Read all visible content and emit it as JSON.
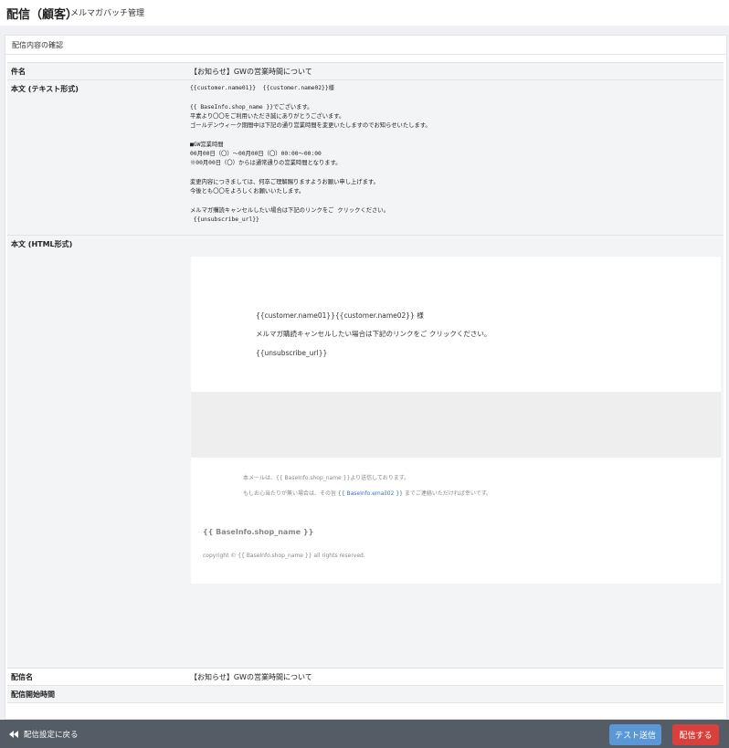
{
  "header": {
    "title": "配信（顧客）",
    "subtitle": "メルマガバッチ管理"
  },
  "card": {
    "title": "配信内容の確認"
  },
  "rows": {
    "subject": {
      "label": "件名",
      "value": "【お知らせ】GWの営業時間について"
    },
    "text_body": {
      "label": "本文 (テキスト形式)",
      "lines": [
        "{{customer.name01}}  {{customer.name02}}様",
        "",
        "{{ BaseInfo.shop_name }}でございます。",
        "平素より〇〇をご利用いただき誠にありがとうございます。",
        "ゴールデンウィーク期間中は下記の通り営業時間を変更いたしますのでお知らせいたします。",
        "",
        "■GW営業時間",
        "00月00日（〇）～00月00日（〇）00:00～00:00",
        "※00月00日（〇）からは通常通りの営業時間となります。",
        "",
        "変更内容につきましては、何卒ご理解賜りますようお願い申し上げます。",
        "今後とも〇〇をよろしくお願いいたします。",
        "",
        "メルマガ購読キャンセルしたい場合は下記のリンクをご クリックください。",
        " {{unsubscribe_url}}"
      ]
    },
    "html_body": {
      "label": "本文 (HTML形式)",
      "greeting": "{{customer.name01}}{{customer.name02}} 様",
      "cancel_text": "メルマガ購読キャンセルしたい場合は下記のリンクをご クリックください。",
      "unsubscribe": "{{unsubscribe_url}}",
      "footer_line1": "本メールは、{{ BaseInfo.shop_name }}より送信しております。",
      "footer_line2_before": "もしお心当たりが無い場合は、その旨 ",
      "footer_line2_link": "{{ BaseInfo.email02 }}",
      "footer_line2_after": " までご連絡いただければ幸いです。",
      "footer_shop": "{{ BaseInfo.shop_name }}",
      "footer_copyright": "copyright © {{ BaseInfo.shop_name }} all rights reserved."
    },
    "delivery_name": {
      "label": "配信名",
      "value": "【お知らせ】GWの営業時間について"
    },
    "delivery_start": {
      "label": "配信開始時間",
      "value": ""
    }
  },
  "footer": {
    "back_label": "配信設定に戻る",
    "test_label": "テスト送信",
    "send_label": "配信する"
  },
  "colors": {
    "test_button": "#5b97d6",
    "send_button": "#d9403b",
    "bottom_bar": "#545c66",
    "link": "#3d72b8"
  }
}
